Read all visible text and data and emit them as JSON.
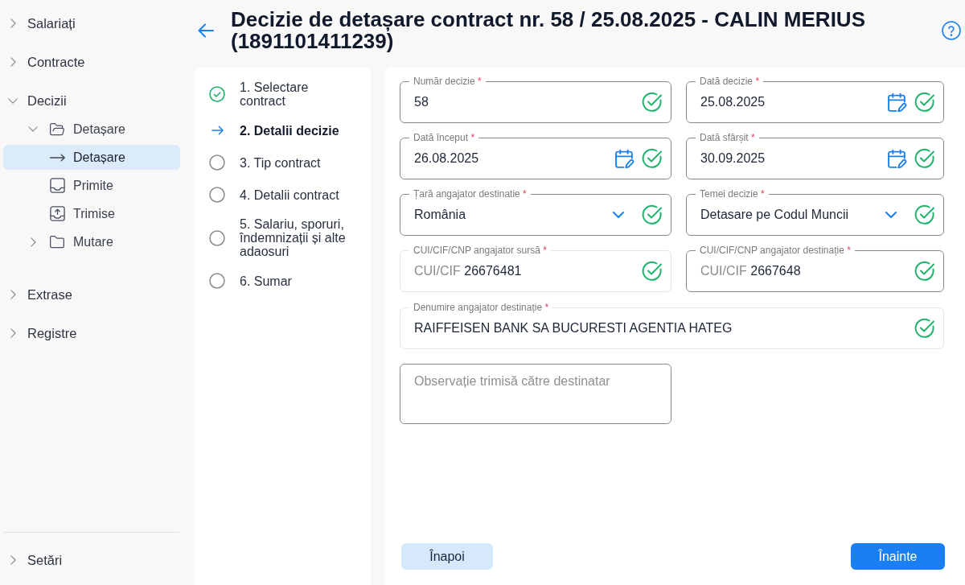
{
  "sidebar": {
    "items": [
      {
        "label": "Salariați",
        "expanded": false,
        "selected": false
      },
      {
        "label": "Contracte",
        "expanded": false,
        "selected": false
      },
      {
        "label": "Decizii",
        "expanded": true,
        "selected": false,
        "children": [
          {
            "label": "Detașare",
            "kind": "folder",
            "expanded": true,
            "selected": false,
            "children": [
              {
                "label": "Detașare",
                "kind": "link",
                "selected": true
              },
              {
                "label": "Primite",
                "kind": "inbox",
                "selected": false
              },
              {
                "label": "Trimise",
                "kind": "outbox",
                "selected": false
              }
            ]
          },
          {
            "label": "Mutare",
            "kind": "folder",
            "expanded": false,
            "selected": false
          }
        ]
      },
      {
        "label": "Extrase",
        "expanded": false,
        "selected": false
      },
      {
        "label": "Registre",
        "expanded": false,
        "selected": false
      }
    ],
    "footer_item": {
      "label": "Setări",
      "expanded": false,
      "selected": false
    }
  },
  "header": {
    "title": "Decizie de detașare contract nr. 58 / 25.08.2025 - CALIN MERIUS (1891101411239)"
  },
  "stepper": {
    "steps": [
      {
        "label": "1. Selectare contract",
        "completed": true,
        "selected": false
      },
      {
        "label": "2. Detalii decizie",
        "completed": false,
        "selected": true
      },
      {
        "label": "3. Tip contract",
        "completed": false,
        "selected": false
      },
      {
        "label": "4. Detalii contract",
        "completed": false,
        "selected": false
      },
      {
        "label": "5. Salariu, sporuri, îndemnizații și alte adaosuri",
        "completed": false,
        "selected": false
      },
      {
        "label": "6. Sumar",
        "completed": false,
        "selected": false
      }
    ]
  },
  "form": {
    "fields": [
      {
        "kind": "text",
        "label": "Număr decizie",
        "required_mark": "*",
        "value": "58",
        "valid": true,
        "disabled": false
      },
      {
        "kind": "date",
        "label": "Dată decizie",
        "required_mark": "*",
        "value": "25.08.2025",
        "valid": true,
        "disabled": false
      },
      {
        "kind": "date",
        "label": "Dată început",
        "required_mark": "*",
        "value": "26.08.2025",
        "valid": true,
        "disabled": false
      },
      {
        "kind": "date",
        "label": "Dată sfârșit",
        "required_mark": "*",
        "value": "30.09.2025",
        "valid": true,
        "disabled": false
      },
      {
        "kind": "select",
        "label": "Țară angajator destinatie",
        "required_mark": "*",
        "value": "România",
        "valid": true,
        "disabled": false
      },
      {
        "kind": "select",
        "label": "Temei decizie",
        "required_mark": "*",
        "value": "Detasare pe Codul Muncii",
        "valid": true,
        "disabled": false
      },
      {
        "kind": "text",
        "label": "CUI/CIF/CNP angajator sursă",
        "required_mark": "*",
        "prefix": "CUI/CIF",
        "value": "26676481",
        "valid": true,
        "disabled": true
      },
      {
        "kind": "text",
        "label": "CUI/CIF/CNP angajator destinație",
        "required_mark": "*",
        "prefix": "CUI/CIF",
        "value": "2667648",
        "valid": true,
        "disabled": false
      }
    ],
    "employer_name_field": {
      "kind": "text",
      "label": "Denumire angajator destinație",
      "required_mark": "*",
      "value": "RAIFFEISEN BANK SA BUCURESTI AGENTIA HATEG",
      "valid": true,
      "disabled": true
    },
    "remark_field": {
      "placeholder": "Observație trimisă către destinatar"
    },
    "buttons": [
      {
        "label": "Înapoi",
        "kind": "secondary"
      },
      {
        "label": "Înainte",
        "kind": "primary"
      }
    ]
  }
}
